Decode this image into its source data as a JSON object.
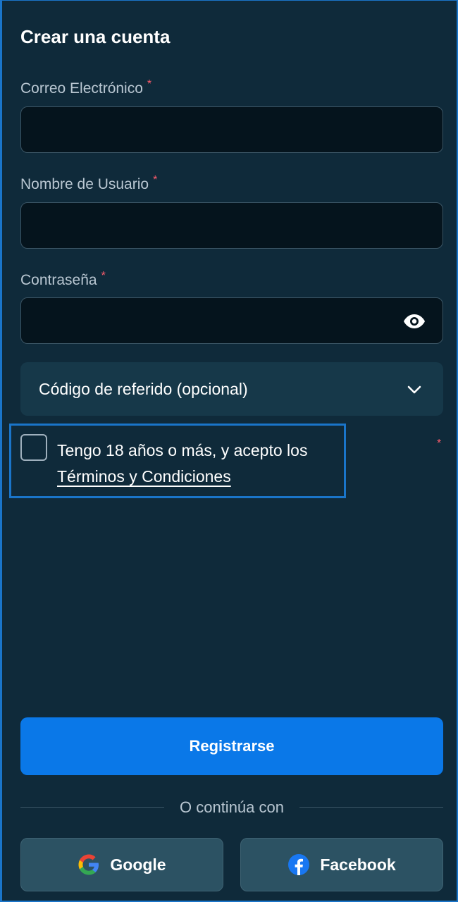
{
  "form": {
    "title": "Crear una cuenta",
    "email": {
      "label": "Correo Electrónico",
      "required_mark": "*",
      "value": ""
    },
    "username": {
      "label": "Nombre de Usuario",
      "required_mark": "*",
      "value": ""
    },
    "password": {
      "label": "Contraseña",
      "required_mark": "*",
      "value": "",
      "toggle_icon": "eye-icon"
    },
    "referral": {
      "label": "Código de referido (opcional)",
      "icon": "chevron-down-icon"
    },
    "terms": {
      "text": "Tengo 18 años o más, y acepto los",
      "link": "Términos y Condiciones",
      "required_mark": "*",
      "checked": false
    },
    "submit_label": "Registrarse",
    "divider_text": "O continúa con",
    "social": [
      {
        "label": "Google",
        "icon": "google-icon"
      },
      {
        "label": "Facebook",
        "icon": "facebook-icon"
      }
    ]
  },
  "colors": {
    "background": "#0f2a3a",
    "field_bg": "#05141d",
    "primary": "#0a78e8",
    "required": "#ff5c6c",
    "social_bg": "#2c5263",
    "highlight": "#1a75c9"
  }
}
